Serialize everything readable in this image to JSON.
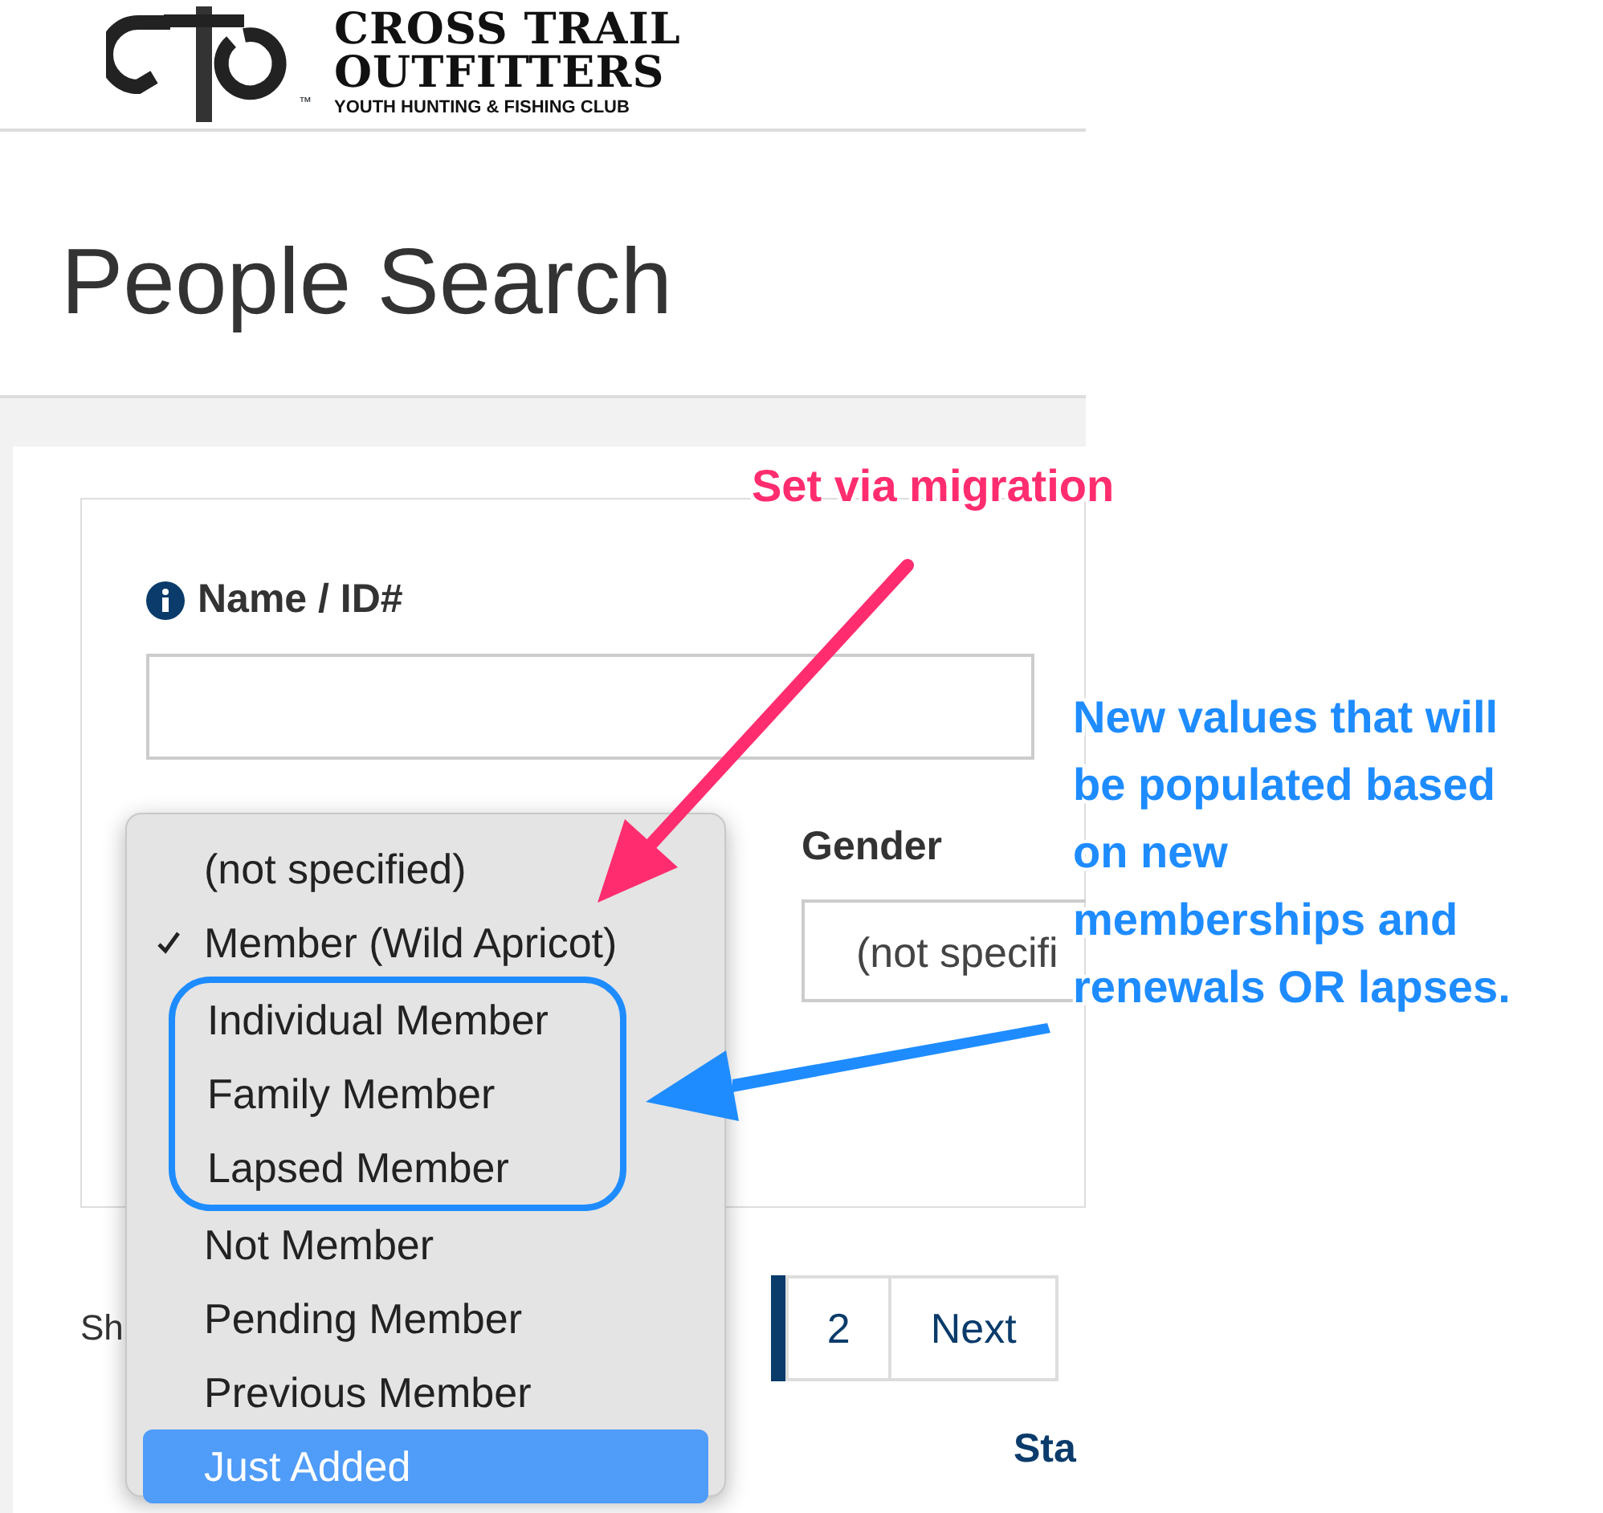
{
  "logo": {
    "line1": "CROSS TRAIL",
    "line2": "OUTFITTERS",
    "tagline": "YOUTH HUNTING & FISHING CLUB",
    "tm": "™"
  },
  "page_title": "People Search",
  "form": {
    "name_label": "Name / ID#",
    "gender_label": "Gender",
    "gender_value": "(not specifi"
  },
  "pagination": {
    "show_text": "Sh",
    "pages": [
      {
        "label": "2",
        "selected": false
      },
      {
        "label": "Next",
        "selected": false
      }
    ]
  },
  "table": {
    "columns": [
      "Sta"
    ]
  },
  "dropdown": {
    "options": [
      {
        "label": "(not specified)",
        "checked": false,
        "highlighted": false
      },
      {
        "label": "Member (Wild Apricot)",
        "checked": true,
        "highlighted": false
      },
      {
        "label": "Individual Member",
        "checked": false,
        "highlighted": false,
        "circled": true
      },
      {
        "label": "Family Member",
        "checked": false,
        "highlighted": false,
        "circled": true
      },
      {
        "label": "Lapsed Member",
        "checked": false,
        "highlighted": false,
        "circled": true
      },
      {
        "label": "Not Member",
        "checked": false,
        "highlighted": false
      },
      {
        "label": "Pending Member",
        "checked": false,
        "highlighted": false
      },
      {
        "label": "Previous Member",
        "checked": false,
        "highlighted": false
      },
      {
        "label": "Just Added",
        "checked": false,
        "highlighted": true
      }
    ]
  },
  "annotations": {
    "pink_note": "Set via migration",
    "blue_note_lines": [
      "New values that will",
      "be populated based",
      "on new",
      "memberships and",
      "renewals OR lapses."
    ]
  }
}
